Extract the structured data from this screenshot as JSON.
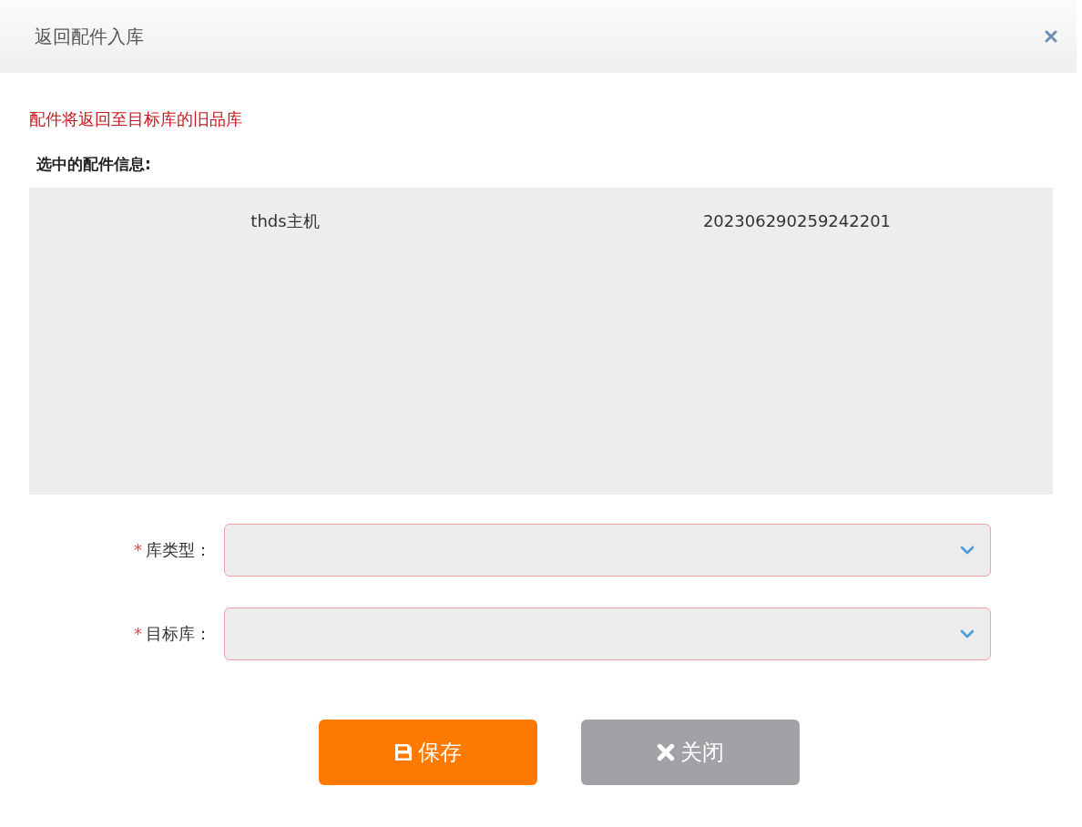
{
  "dialog": {
    "title": "返回配件入库"
  },
  "notice": "配件将返回至目标库的旧品库",
  "selected_parts": {
    "label": "选中的配件信息:",
    "rows": [
      {
        "name": "thds主机",
        "code": "202306290259242201"
      }
    ]
  },
  "fields": [
    {
      "required_mark": "*",
      "label": "库类型："
    },
    {
      "required_mark": "*",
      "label": "目标库："
    }
  ],
  "buttons": [
    {
      "kind": "save",
      "label": "保存"
    },
    {
      "kind": "close",
      "label": "关闭"
    }
  ]
}
